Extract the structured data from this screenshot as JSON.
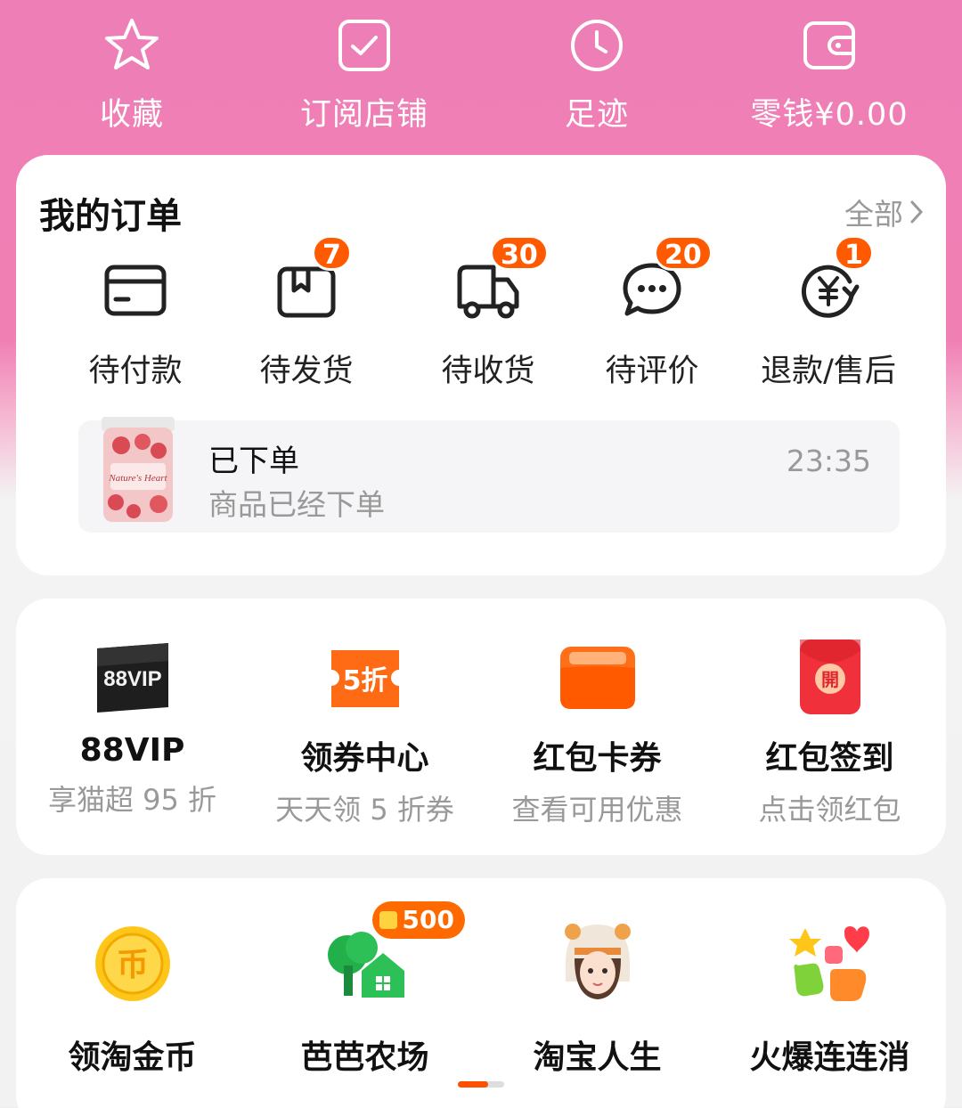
{
  "quick_bar": [
    {
      "icon": "star-icon",
      "label": "收藏"
    },
    {
      "icon": "checkbox-icon",
      "label": "订阅店铺"
    },
    {
      "icon": "clock-icon",
      "label": "足迹"
    },
    {
      "icon": "wallet-icon",
      "label": "零钱¥0.00"
    }
  ],
  "orders": {
    "title": "我的订单",
    "all_label": "全部",
    "statuses": [
      {
        "icon": "card-icon",
        "label": "待付款",
        "badge": ""
      },
      {
        "icon": "box-icon",
        "label": "待发货",
        "badge": "7"
      },
      {
        "icon": "truck-icon",
        "label": "待收货",
        "badge": "30"
      },
      {
        "icon": "chat-icon",
        "label": "待评价",
        "badge": "20"
      },
      {
        "icon": "refund-icon",
        "label": "退款/售后",
        "badge": "1"
      }
    ],
    "recent": {
      "title": "已下单",
      "subtitle": "商品已经下单",
      "time": "23:35",
      "product_label": "Nature's Heart"
    }
  },
  "benefits": [
    {
      "icon": "vip-card-icon",
      "icon_text": "88VIP",
      "title": "88VIP",
      "subtitle": "享猫超 95 折"
    },
    {
      "icon": "coupon-icon",
      "icon_text": "5折",
      "title": "领券中心",
      "subtitle": "天天领 5 折券"
    },
    {
      "icon": "wallet-folder-icon",
      "icon_text": "",
      "title": "红包卡券",
      "subtitle": "查看可用优惠"
    },
    {
      "icon": "red-envelope-icon",
      "icon_text": "開",
      "title": "红包签到",
      "subtitle": "点击领红包"
    }
  ],
  "games": [
    {
      "icon": "gold-coin-icon",
      "icon_text": "币",
      "title": "领淘金币",
      "badge": ""
    },
    {
      "icon": "farm-tree-icon",
      "icon_text": "",
      "title": "芭芭农场",
      "badge": "500"
    },
    {
      "icon": "avatar-girl-icon",
      "icon_text": "",
      "title": "淘宝人生",
      "badge": ""
    },
    {
      "icon": "match-blocks-icon",
      "icon_text": "",
      "title": "火爆连连消",
      "badge": ""
    }
  ],
  "pager": {
    "active_index": 0,
    "count": 2
  },
  "colors": {
    "header_pink": "#ee7fb6",
    "accent_orange": "#ff5a00",
    "text_gray": "#999999"
  }
}
